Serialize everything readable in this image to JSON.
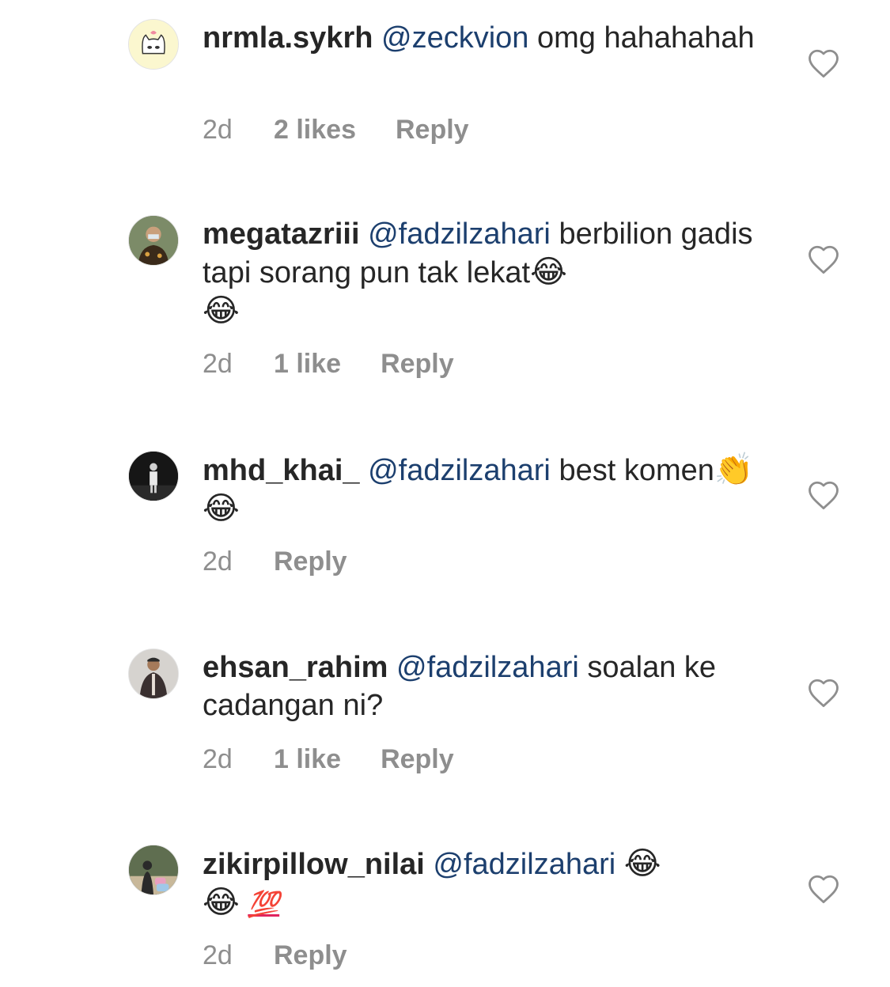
{
  "comments": [
    {
      "username": "nrmla.sykrh",
      "mention": "@zeckvion",
      "text": "omg hahahahah",
      "time": "2d",
      "likes": "2 likes",
      "reply": "Reply"
    },
    {
      "username": "megatazriii",
      "mention": "@fadzilzahari",
      "text": "berbilion gadis tapi sorang pun tak lekat",
      "emoji": "😂",
      "emoji_tail": "😂",
      "time": "2d",
      "likes": "1 like",
      "reply": "Reply"
    },
    {
      "username": "mhd_khai_",
      "mention": "@fadzilzahari",
      "text": "best komen",
      "emoji_clap": "👏",
      "emoji": "😂",
      "time": "2d",
      "reply": "Reply"
    },
    {
      "username": "ehsan_rahim",
      "mention": "@fadzilzahari",
      "text": "soalan ke cadangan ni?",
      "time": "2d",
      "likes": "1 like",
      "reply": "Reply"
    },
    {
      "username": "zikirpillow_nilai",
      "mention": "@fadzilzahari",
      "emoji": "😂",
      "emoji_tail": "😂",
      "hundred": "💯",
      "time": "2d",
      "reply": "Reply"
    }
  ],
  "icons": {
    "like": "heart-outline-icon"
  },
  "colors": {
    "mention": "#1c3f6e",
    "meta": "#8e8e8e",
    "heart_stroke": "#8e8e8e"
  }
}
